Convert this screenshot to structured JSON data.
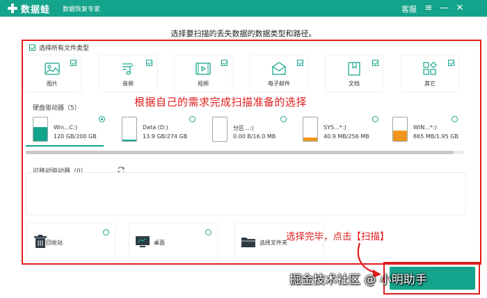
{
  "app": {
    "logo_text": "数据蛙",
    "subtitle": "数据恢复专家",
    "kefu": "客服",
    "menu_icon": "≡",
    "min_icon": "—",
    "close_icon": "✕"
  },
  "instruction": "选择要扫描的丢失数据的数据类型和路径。",
  "select_all_label": "选择所有文件类型",
  "file_types": [
    {
      "label": "图片",
      "icon": "image-icon",
      "checked": true
    },
    {
      "label": "音频",
      "icon": "music-icon",
      "checked": true
    },
    {
      "label": "视频",
      "icon": "video-icon",
      "checked": true
    },
    {
      "label": "电子邮件",
      "icon": "email-icon",
      "checked": true
    },
    {
      "label": "文档",
      "icon": "document-icon",
      "checked": true
    },
    {
      "label": "其它",
      "icon": "other-icon",
      "checked": true
    }
  ],
  "hard_drives": {
    "title": "硬盘驱动器（5）",
    "items": [
      {
        "name": "Win...C:)",
        "size": "120 GB/200 GB",
        "used_fraction": 0.6,
        "selected": true,
        "fill_color": "#14a38b"
      },
      {
        "name": "Data (D:)",
        "size": "13.9 GB/274 GB",
        "used_fraction": 0.05,
        "selected": false,
        "fill_color": "#14a38b"
      },
      {
        "name": "分区...:)",
        "size": "0.00  B/16.0 MB",
        "used_fraction": 0.0,
        "selected": false,
        "fill_color": "#14a38b"
      },
      {
        "name": "SYS...*:)",
        "size": "40.9 MB/256 MB",
        "used_fraction": 0.16,
        "selected": false,
        "fill_color": "#f0961e"
      },
      {
        "name": "WIN...*:)",
        "size": "865 MB/1.95 GB",
        "used_fraction": 0.44,
        "selected": false,
        "fill_color": "#f0961e"
      }
    ]
  },
  "removable": {
    "title": "可移动驱动器（0）"
  },
  "locations": [
    {
      "label": "回收站",
      "icon": "recycle-bin-icon"
    },
    {
      "label": "桌面",
      "icon": "desktop-icon"
    },
    {
      "label": "选择文件夹",
      "icon": "folder-icon"
    }
  ],
  "annotations": {
    "top": "根据自己的需求完成扫描准备的选择",
    "bottom": "选择完毕，点击【扫描】"
  },
  "watermark": "掘金技术社区 @ 小明助手",
  "colors": {
    "accent": "#14a38b",
    "annotation_red": "#e21b1b",
    "drive_warn": "#f0961e"
  }
}
